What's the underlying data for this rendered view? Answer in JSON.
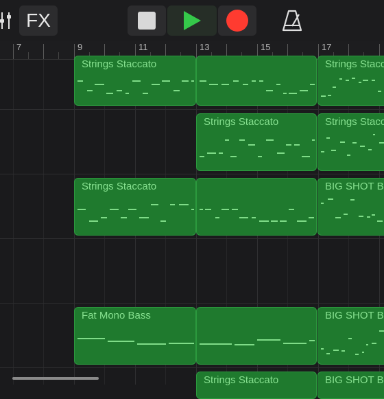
{
  "toolbar": {
    "fx_label": "FX",
    "mixer_icon": "mixer-sliders-icon",
    "stop_icon": "stop-icon",
    "play_icon": "play-icon",
    "record_icon": "record-icon",
    "metronome_icon": "metronome-icon",
    "colors": {
      "play": "#35c84a",
      "record": "#ff3b30",
      "stop": "#d8d8d8"
    }
  },
  "ruler": {
    "bars": [
      "7",
      "9",
      "11",
      "13",
      "15",
      "17"
    ]
  },
  "tracks": [
    {
      "regions": [
        {
          "title": "Strings Staccato"
        },
        {
          "title": ""
        },
        {
          "title": "Strings Staccato"
        }
      ]
    },
    {
      "regions": [
        {
          "title": "Strings Staccato"
        },
        {
          "title": "Strings Staccato"
        }
      ]
    },
    {
      "regions": [
        {
          "title": "Strings Staccato"
        },
        {
          "title": ""
        },
        {
          "title": "BIG SHOT B"
        }
      ]
    },
    {
      "regions": []
    },
    {
      "regions": [
        {
          "title": "Fat Mono Bass"
        },
        {
          "title": ""
        },
        {
          "title": "BIG SHOT B"
        }
      ]
    },
    {
      "regions": [
        {
          "title": "Strings Staccato"
        },
        {
          "title": "BIG SHOT B"
        }
      ]
    }
  ],
  "colors": {
    "region_fill": "#1f7a2e",
    "region_text": "#86e08f",
    "background": "#1a1a1c"
  }
}
